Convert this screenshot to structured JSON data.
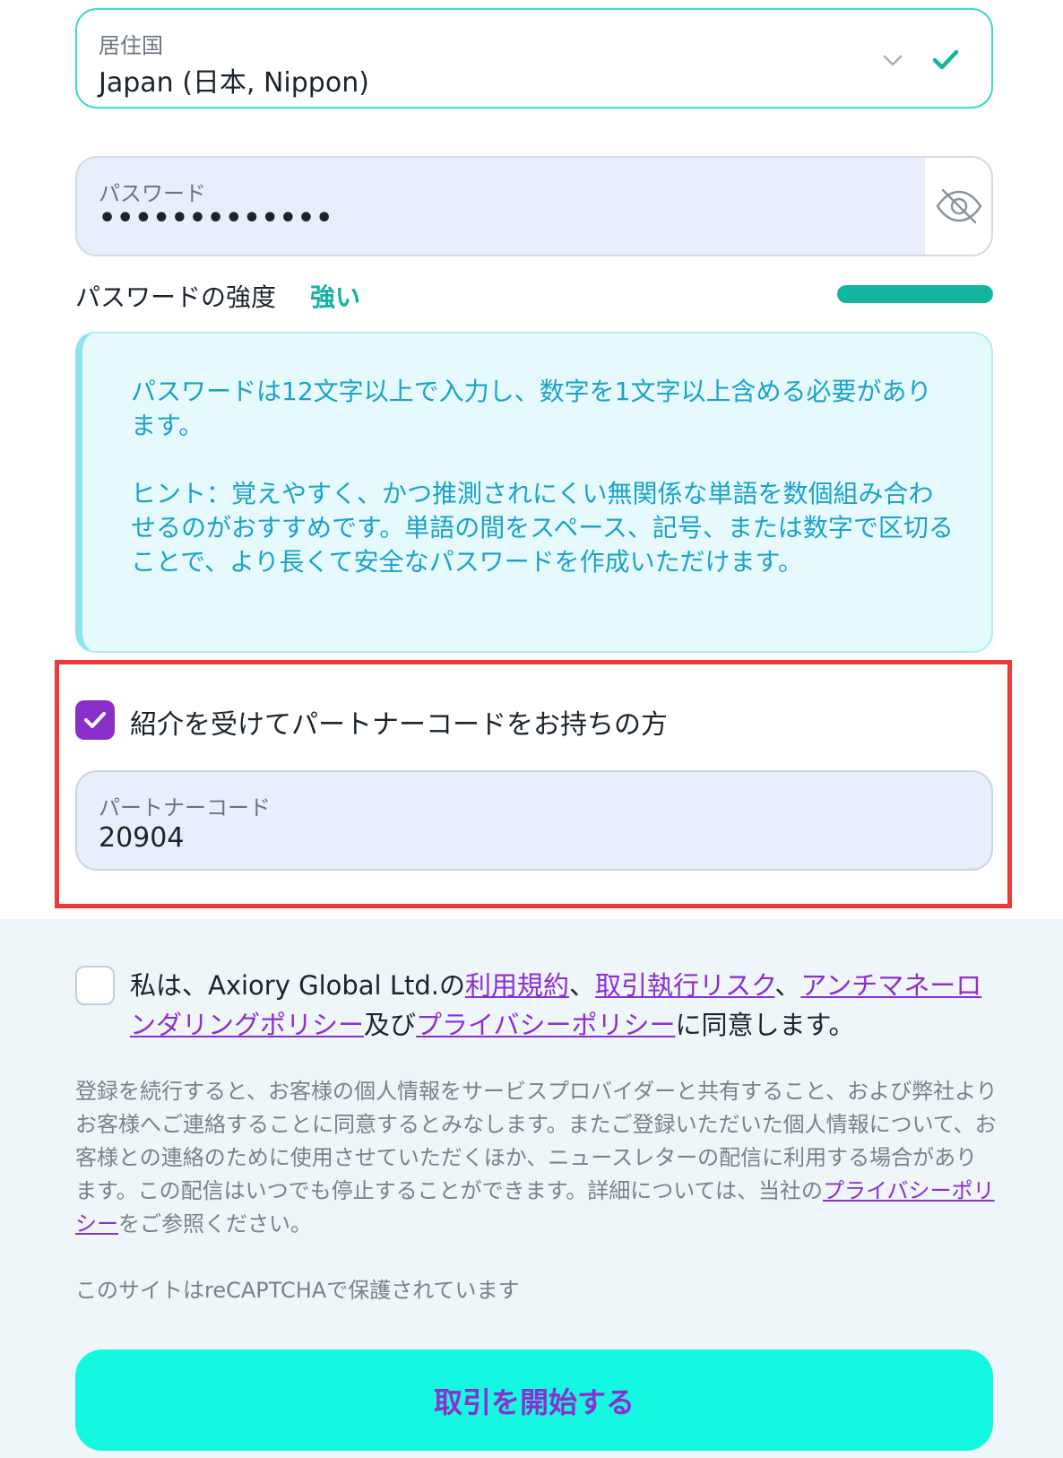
{
  "country": {
    "label": "居住国",
    "value": "Japan (日本, Nippon)"
  },
  "password": {
    "label": "パスワード",
    "value_masked": "•••••••••••••"
  },
  "strength": {
    "label": "パスワードの強度",
    "value": "強い",
    "level_fraction": 1.0
  },
  "hint": {
    "requirement": "パスワードは12文字以上で入力し、数字を1文字以上含める必要があります。",
    "tip": "ヒント：覚えやすく、かつ推測されにくい無関係な単語を数個組み合わせるのがおすすめです。単語の間をスペース、記号、または数字で区切ることで、より長くて安全なパスワードを作成いただけます。"
  },
  "partner": {
    "checkbox_label": "紹介を受けてパートナーコードをお持ちの方",
    "checked": true,
    "field_label": "パートナーコード",
    "field_value": "20904"
  },
  "terms": {
    "prefix": "私は、Axiory Global Ltd.の",
    "link_terms": "利用規約",
    "sep1": "、",
    "link_execution_risk": "取引執行リスク",
    "sep2": "、",
    "link_aml": "アンチマネーロンダリングポリシー",
    "and": "及び",
    "link_privacy": "プライバシーポリシー",
    "suffix": "に同意します。"
  },
  "consent": {
    "text": "登録を続行すると、お客様の個人情報をサービスプロバイダーと共有すること、および弊社よりお客様へご連絡することに同意するとみなします。またご登録いただいた個人情報について、お客様との連絡のために使用させていただくほか、ニュースレターの配信に利用する場合があります。この配信はいつでも停止することができます。詳細については、当社の",
    "link_privacy": "プライバシーポリシー",
    "suffix": "をご参照ください。"
  },
  "recaptcha": {
    "text": "このサイトはreCAPTCHAで保護されています"
  },
  "submit": {
    "label": "取引を開始する"
  },
  "colors": {
    "accent_teal": "#14f7e0",
    "purple": "#8c2fd0",
    "strength_green": "#12b59e",
    "highlight_red": "#ef3a3a"
  }
}
